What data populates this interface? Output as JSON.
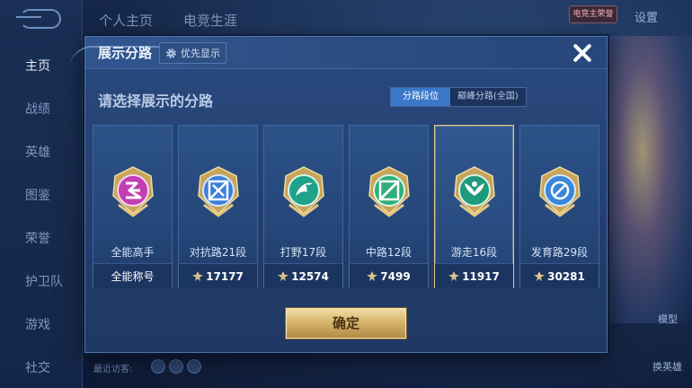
{
  "background": {
    "nav_items": [
      "主页",
      "战绩",
      "英雄",
      "图鉴",
      "荣誉",
      "护卫队",
      "游戏",
      "社交"
    ],
    "tabs": [
      "个人主页",
      "电竞生涯"
    ],
    "settings_label": "设置",
    "badge_text": "电竞主荣誉",
    "right_labels": [
      "模型",
      "换英雄"
    ],
    "visitors_label": "最近访客:"
  },
  "modal": {
    "title": "展示分路",
    "priority_label": "优先显示",
    "subtitle": "请选择展示的分路",
    "toggle": {
      "options": [
        "分路段位",
        "巅峰分路(全国)"
      ],
      "selected": "分路段位"
    },
    "confirm_label": "确定",
    "cards": [
      {
        "rank": "全能高手",
        "footer": "全能称号",
        "emblem": "all-round-emblem",
        "color": "#c23fb3",
        "selected": false
      },
      {
        "rank": "对抗路21段",
        "footer": "17177",
        "emblem": "clash-lane-emblem",
        "color": "#3b7fd8",
        "selected": false
      },
      {
        "rank": "打野17段",
        "footer": "12574",
        "emblem": "jungle-emblem",
        "color": "#1ea38a",
        "selected": false
      },
      {
        "rank": "中路12段",
        "footer": "7499",
        "emblem": "mid-lane-emblem",
        "color": "#2fae7a",
        "selected": false
      },
      {
        "rank": "游走16段",
        "footer": "11917",
        "emblem": "roam-emblem",
        "color": "#1f9a7a",
        "selected": true
      },
      {
        "rank": "发育路29段",
        "footer": "30281",
        "emblem": "farm-lane-emblem",
        "color": "#3a86d9",
        "selected": false
      }
    ]
  },
  "colors": {
    "accent_blue": "#3b78c9",
    "selected_border": "#e3c98a",
    "gold": "#d7b56d"
  }
}
